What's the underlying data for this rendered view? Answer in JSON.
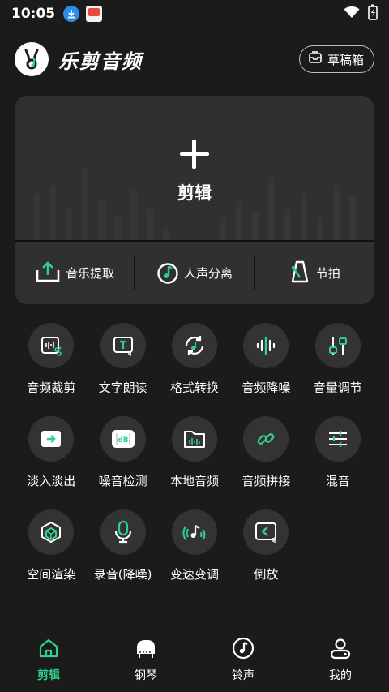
{
  "status": {
    "time": "10:05"
  },
  "header": {
    "title": "乐剪音频",
    "draft_label": "草稿箱"
  },
  "edit_card": {
    "label": "剪辑",
    "sub_actions": [
      {
        "label": "音乐提取",
        "icon": "upload-tray-icon"
      },
      {
        "label": "人声分离",
        "icon": "music-note-circle-icon"
      },
      {
        "label": "节拍",
        "icon": "metronome-icon"
      }
    ]
  },
  "tools": [
    {
      "label": "音频裁剪",
      "icon": "audio-trim-icon"
    },
    {
      "label": "文字朗读",
      "icon": "text-to-speech-icon"
    },
    {
      "label": "格式转换",
      "icon": "format-convert-icon"
    },
    {
      "label": "音频降噪",
      "icon": "noise-reduction-icon"
    },
    {
      "label": "音量调节",
      "icon": "volume-slider-icon"
    },
    {
      "label": "淡入淡出",
      "icon": "fade-in-out-icon"
    },
    {
      "label": "噪音检测",
      "icon": "decibel-meter-icon"
    },
    {
      "label": "本地音频",
      "icon": "folder-audio-icon"
    },
    {
      "label": "音频拼接",
      "icon": "link-icon"
    },
    {
      "label": "混音",
      "icon": "mixer-sliders-icon"
    },
    {
      "label": "空间渲染",
      "icon": "cube-icon"
    },
    {
      "label": "录音(降噪)",
      "icon": "microphone-icon"
    },
    {
      "label": "变速变调",
      "icon": "speed-pitch-icon"
    },
    {
      "label": "倒放",
      "icon": "reverse-play-icon"
    }
  ],
  "bottom_nav": [
    {
      "label": "剪辑",
      "icon": "home-icon",
      "active": true
    },
    {
      "label": "钢琴",
      "icon": "piano-icon",
      "active": false
    },
    {
      "label": "铃声",
      "icon": "music-disc-icon",
      "active": false
    },
    {
      "label": "我的",
      "icon": "profile-icon",
      "active": false
    }
  ],
  "colors": {
    "accent": "#2fd18c",
    "background": "#1b1b1b",
    "card": "#303030",
    "circle": "#333333"
  }
}
